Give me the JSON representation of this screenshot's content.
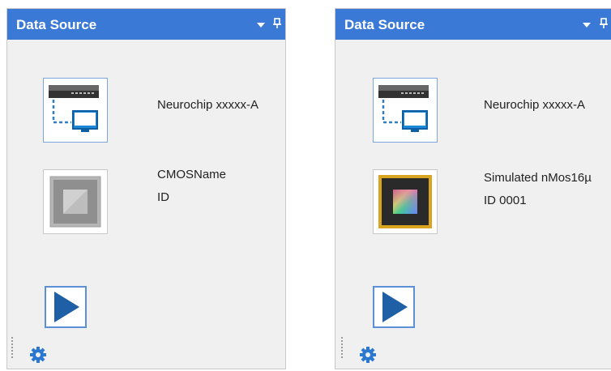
{
  "panels": [
    {
      "title": "Data Source",
      "device_label": "Neurochip xxxxx-A",
      "chip_name": "CMOSName",
      "chip_id": "ID",
      "chip_state": "inactive"
    },
    {
      "title": "Data Source",
      "device_label": "Neurochip xxxxx-A",
      "chip_name": "Simulated nMos16µ",
      "chip_id": "ID 0001",
      "chip_state": "active"
    }
  ],
  "icons": {
    "dropdown": "chevron-down-icon",
    "pin": "pin-icon",
    "device": "network-device-icon",
    "chip": "chip-icon",
    "play": "play-icon",
    "settings": "gear-icon"
  },
  "colors": {
    "header": "#3b79d7",
    "panel_bg": "#f0f0f0",
    "play": "#1f5fa6"
  }
}
